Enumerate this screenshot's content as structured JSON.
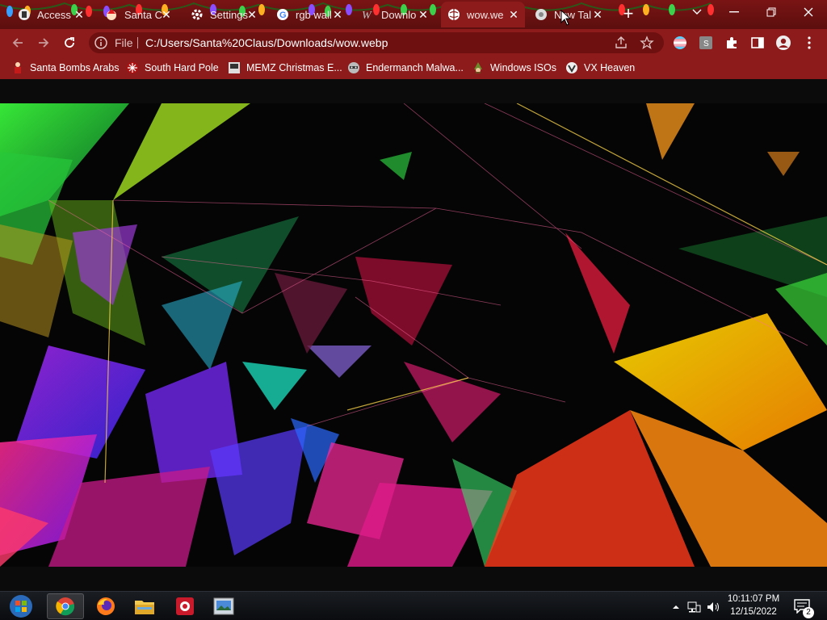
{
  "browser": {
    "tabs": [
      {
        "title": "Access",
        "icon": "access-icon"
      },
      {
        "title": "Santa C",
        "icon": "santa-icon"
      },
      {
        "title": "Settings",
        "icon": "settings-gear-icon"
      },
      {
        "title": "rgb wall",
        "icon": "google-icon"
      },
      {
        "title": "Downlo",
        "icon": "download-w-icon"
      },
      {
        "title": "wow.we",
        "icon": "globe-icon"
      },
      {
        "title": "New Tal",
        "icon": "chrome-icon"
      }
    ],
    "active_tab_index": 5,
    "omnibox": {
      "scheme_label": "File",
      "url": "C:/Users/Santa%20Claus/Downloads/wow.webp"
    },
    "bookmarks": [
      {
        "label": "Santa Bombs Arabs",
        "icon": "santa-figure-icon"
      },
      {
        "label": "South Hard Pole",
        "icon": "snowflake-icon"
      },
      {
        "label": "MEMZ Christmas E...",
        "icon": "memz-icon"
      },
      {
        "label": "Endermanch Malwa...",
        "icon": "raccoon-icon"
      },
      {
        "label": "Windows ISOs",
        "icon": "gnome-icon"
      },
      {
        "label": "VX Heaven",
        "icon": "vx-heaven-icon"
      }
    ],
    "accent_color": "#8e1b1b"
  },
  "taskbar": {
    "time": "10:11:07 PM",
    "date": "12/15/2022",
    "notification_count": "2"
  }
}
